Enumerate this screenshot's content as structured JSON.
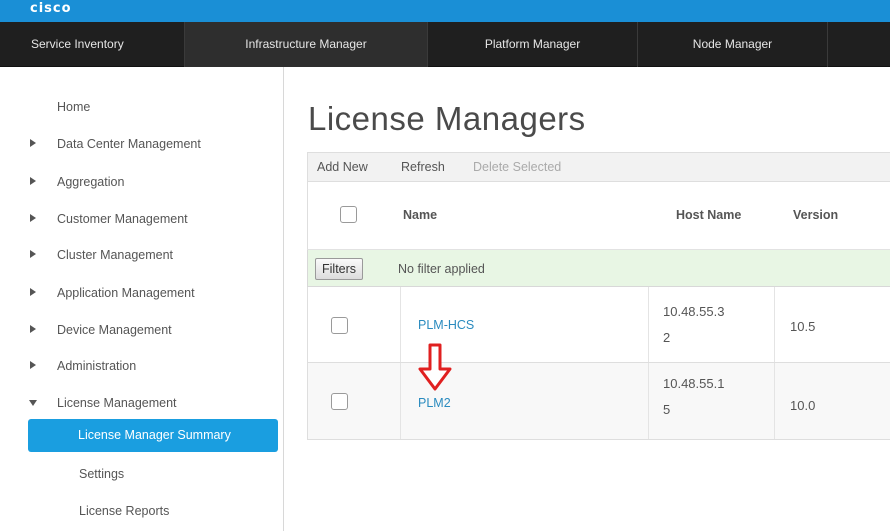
{
  "brand": {
    "logo_text": "cisco"
  },
  "nav": {
    "tabs": [
      {
        "label": "Service Inventory"
      },
      {
        "label": "Infrastructure Manager"
      },
      {
        "label": "Platform Manager"
      },
      {
        "label": "Node Manager"
      }
    ]
  },
  "sidebar": {
    "home": "Home",
    "items": [
      {
        "label": "Data Center Management"
      },
      {
        "label": "Aggregation"
      },
      {
        "label": "Customer Management"
      },
      {
        "label": "Cluster Management"
      },
      {
        "label": "Application Management"
      },
      {
        "label": "Device Management"
      },
      {
        "label": "Administration"
      },
      {
        "label": "License Management"
      }
    ],
    "sub_items": [
      {
        "label": "License Manager Summary"
      },
      {
        "label": "Settings"
      },
      {
        "label": "License Reports"
      }
    ]
  },
  "main": {
    "title": "License Managers",
    "toolbar": {
      "add_new": "Add New",
      "refresh": "Refresh",
      "delete_selected": "Delete Selected"
    },
    "table": {
      "columns": {
        "name": "Name",
        "host_name": "Host Name",
        "version": "Version"
      },
      "filters_button": "Filters",
      "filter_status": "No filter applied",
      "rows": [
        {
          "name": "PLM-HCS",
          "host_line1": "10.48.55.3",
          "host_line2": "2",
          "version": "10.5"
        },
        {
          "name": "PLM2",
          "host_line1": "10.48.55.1",
          "host_line2": "5",
          "version": "10.0"
        }
      ]
    }
  },
  "colors": {
    "banner_blue": "#1a8fd6",
    "nav_dark": "#1f1f1f",
    "selected_blue": "#1a9ee0",
    "link_blue": "#2a8bbf",
    "filter_green": "#e8f6e4",
    "annotation_red": "#e02020"
  }
}
